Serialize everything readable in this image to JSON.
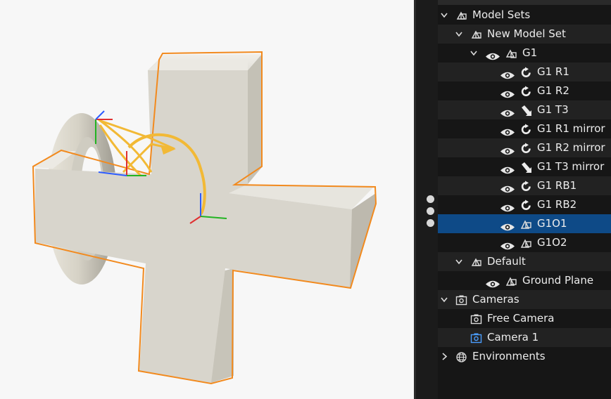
{
  "tree": {
    "rows": [
      {
        "label": "Model Sets",
        "icon": "model-set-icon",
        "chevron": "chevron-down-icon",
        "eye": false,
        "depth": 0
      },
      {
        "label": "New Model Set",
        "icon": "model-set-icon",
        "chevron": "chevron-down-icon",
        "eye": false,
        "depth": 1
      },
      {
        "label": "G1",
        "icon": "model-group-icon",
        "chevron": "chevron-down-icon",
        "eye": true,
        "depth": 2
      },
      {
        "label": "G1 R1",
        "icon": "rotation-joint-icon",
        "chevron": null,
        "eye": true,
        "depth": 3
      },
      {
        "label": "G1 R2",
        "icon": "rotation-joint-icon",
        "chevron": null,
        "eye": true,
        "depth": 3
      },
      {
        "label": "G1 T3",
        "icon": "translation-joint-icon",
        "chevron": null,
        "eye": true,
        "depth": 3
      },
      {
        "label": "G1 R1 mirror",
        "icon": "rotation-joint-icon",
        "chevron": null,
        "eye": true,
        "depth": 3
      },
      {
        "label": "G1 R2 mirror",
        "icon": "rotation-joint-icon",
        "chevron": null,
        "eye": true,
        "depth": 3
      },
      {
        "label": "G1 T3 mirror",
        "icon": "translation-joint-icon",
        "chevron": null,
        "eye": true,
        "depth": 3
      },
      {
        "label": "G1 RB1",
        "icon": "rotation-joint-icon",
        "chevron": null,
        "eye": true,
        "depth": 3
      },
      {
        "label": "G1 RB2",
        "icon": "rotation-joint-icon",
        "chevron": null,
        "eye": true,
        "depth": 3
      },
      {
        "label": "G1O1",
        "icon": "model-object-icon",
        "chevron": null,
        "eye": true,
        "depth": 3,
        "selected": true
      },
      {
        "label": "G1O2",
        "icon": "model-object-icon",
        "chevron": null,
        "eye": true,
        "depth": 3
      },
      {
        "label": "Default",
        "icon": "model-set-icon",
        "chevron": "chevron-down-icon",
        "eye": false,
        "depth": 1
      },
      {
        "label": "Ground Plane",
        "icon": "model-object-icon",
        "chevron": null,
        "eye": true,
        "depth": 2
      },
      {
        "label": "Cameras",
        "icon": "camera-icon",
        "chevron": "chevron-down-icon",
        "eye": false,
        "depth": 0
      },
      {
        "label": "Free Camera",
        "icon": "camera-icon",
        "chevron": null,
        "eye": false,
        "depth": 1
      },
      {
        "label": "Camera 1",
        "icon": "camera-active-icon",
        "chevron": null,
        "eye": false,
        "depth": 1
      },
      {
        "label": "Environments",
        "icon": "globe-icon",
        "chevron": "chevron-right-icon",
        "eye": false,
        "depth": 0
      }
    ]
  },
  "colors": {
    "selection": "#0e4a87",
    "outline": "#f28a1e",
    "joint_path": "#f2b935",
    "camera_active": "#4a9eff"
  }
}
